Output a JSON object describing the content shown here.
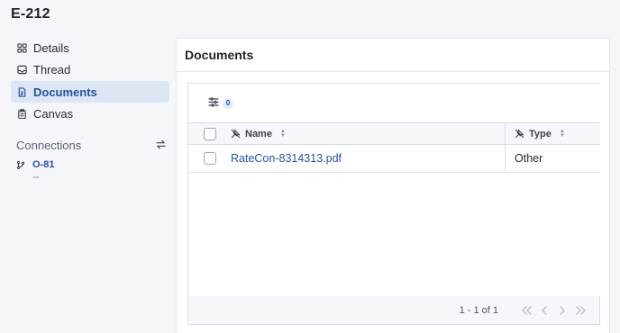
{
  "page": {
    "title": "E-212"
  },
  "sidebar": {
    "items": [
      {
        "label": "Details",
        "icon": "grid-icon"
      },
      {
        "label": "Thread",
        "icon": "inbox-icon"
      },
      {
        "label": "Documents",
        "icon": "document-icon",
        "active": true
      },
      {
        "label": "Canvas",
        "icon": "clipboard-icon"
      }
    ]
  },
  "connections": {
    "heading": "Connections",
    "items": [
      {
        "label": "O-81",
        "sub": "--",
        "icon": "branch-icon"
      }
    ]
  },
  "documents": {
    "title": "Documents",
    "filter_count": "0",
    "columns": [
      {
        "label": "Name"
      },
      {
        "label": "Type"
      }
    ],
    "rows": [
      {
        "name": "RateCon-8314313.pdf",
        "type": "Other"
      }
    ],
    "pagination": "1 - 1 of 1"
  },
  "colors": {
    "accent": "#2452a8",
    "active_bg": "#dde6f4",
    "background": "#f4f6fa"
  }
}
